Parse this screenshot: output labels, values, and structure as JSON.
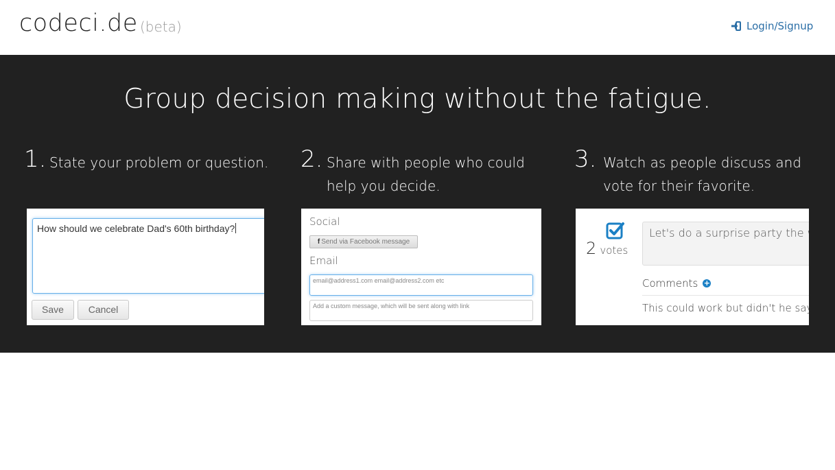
{
  "header": {
    "brand": "codeci.de",
    "beta": "(beta)",
    "login_label": "Login/Signup"
  },
  "hero": {
    "title": "Group decision making without the fatigue.",
    "steps": [
      {
        "num": "1.",
        "text": "State your problem or question."
      },
      {
        "num": "2.",
        "text": "Share with people who could help you decide."
      },
      {
        "num": "3.",
        "text": "Watch as people discuss and vote for their favorite."
      }
    ]
  },
  "panel1": {
    "question_value": "How should we celebrate Dad's 60th birthday?",
    "save_label": "Save",
    "cancel_label": "Cancel"
  },
  "panel2": {
    "social_label": "Social",
    "facebook_icon": "f",
    "facebook_label": "Send via Facebook message",
    "email_label": "Email",
    "email_placeholder": "email@address1.com email@address2.com etc",
    "message_placeholder": "Add a custom message, which will be sent along with link"
  },
  "panel3": {
    "vote_count": "2",
    "votes_word": "votes",
    "idea_text": "Let's do a surprise party the w",
    "comments_label": "Comments",
    "comment_text": "This could work but didn't he say"
  },
  "colors": {
    "hero_bg": "#212121",
    "link": "#2a6ea6",
    "accent": "#1b80c5"
  }
}
